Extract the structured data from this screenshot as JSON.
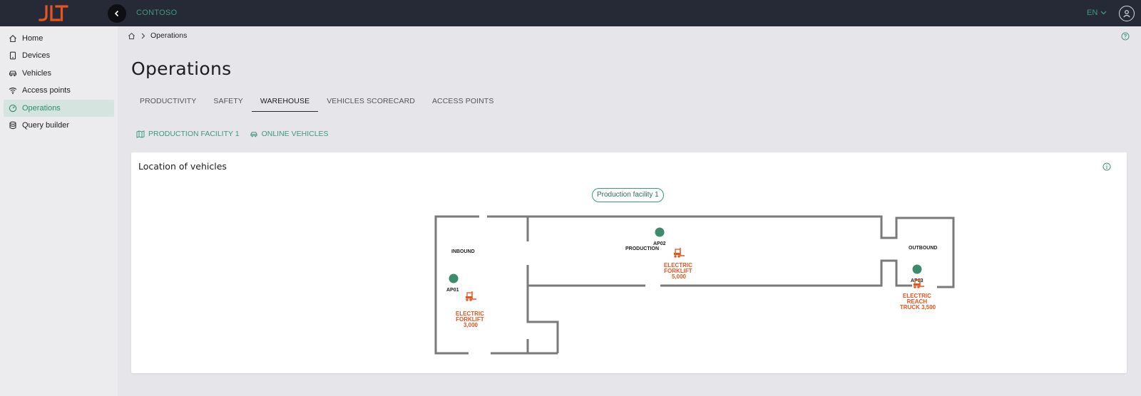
{
  "app": {
    "brand": "CONTOSO",
    "language": "EN",
    "colors": {
      "accent": "#3d9a7a",
      "topbar": "#262a36",
      "logo": "#e8541e",
      "vehicle": "#e8541e"
    }
  },
  "sidebar": {
    "items": [
      {
        "label": "Home",
        "icon": "home-icon"
      },
      {
        "label": "Devices",
        "icon": "tablet-icon"
      },
      {
        "label": "Vehicles",
        "icon": "car-icon"
      },
      {
        "label": "Access points",
        "icon": "wifi-icon"
      },
      {
        "label": "Operations",
        "icon": "gauge-icon",
        "active": true
      },
      {
        "label": "Query builder",
        "icon": "database-icon"
      }
    ]
  },
  "breadcrumb": {
    "current": "Operations"
  },
  "page": {
    "title": "Operations"
  },
  "tabs": [
    {
      "label": "PRODUCTIVITY"
    },
    {
      "label": "SAFETY"
    },
    {
      "label": "WAREHOUSE",
      "active": true
    },
    {
      "label": "VEHICLES SCORECARD"
    },
    {
      "label": "ACCESS POINTS"
    }
  ],
  "filters": [
    {
      "label": "PRODUCTION FACILITY 1",
      "icon": "map-icon"
    },
    {
      "label": "ONLINE VEHICLES",
      "icon": "car-icon"
    }
  ],
  "card": {
    "title": "Location of vehicles",
    "facility": "Production facility 1",
    "zones": [
      "INBOUND",
      "PRODUCTION",
      "OUTBOUND"
    ],
    "access_points": [
      "AP01",
      "AP02",
      "AP03"
    ],
    "vehicles": [
      {
        "lines": [
          "ELECTRIC",
          "FORKLIFT",
          "3,000"
        ]
      },
      {
        "lines": [
          "ELECTRIC",
          "FORKLIFT",
          "5,000"
        ]
      },
      {
        "lines": [
          "ELECTRIC",
          "REACH",
          "TRUCK 3,500"
        ]
      }
    ]
  }
}
